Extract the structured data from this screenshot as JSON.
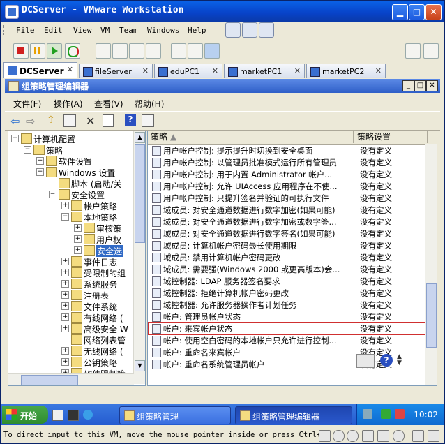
{
  "window": {
    "title": "DCServer - VMware Workstation"
  },
  "menu": [
    "File",
    "Edit",
    "View",
    "VM",
    "Team",
    "Windows",
    "Help"
  ],
  "tabs": [
    {
      "label": "DCServer",
      "active": true
    },
    {
      "label": "fileServer"
    },
    {
      "label": "eduPC1"
    },
    {
      "label": "marketPC1"
    },
    {
      "label": "marketPC2"
    }
  ],
  "inner": {
    "title": "组策略管理编辑器",
    "menu": [
      "文件(F)",
      "操作(A)",
      "查看(V)",
      "帮助(H)"
    ]
  },
  "tree": [
    {
      "label": "计算机配置",
      "exp": "−"
    },
    {
      "label": "策略",
      "exp": "−"
    },
    {
      "label": "软件设置",
      "exp": "+"
    },
    {
      "label": "Windows 设置",
      "exp": "−"
    },
    {
      "label": "脚本 (启动/关",
      "exp": ""
    },
    {
      "label": "安全设置",
      "exp": "−"
    },
    {
      "label": "帐户策略",
      "exp": "+"
    },
    {
      "label": "本地策略",
      "exp": "−"
    },
    {
      "label": "审核策",
      "exp": "+"
    },
    {
      "label": "用户权",
      "exp": "+"
    },
    {
      "label": "安全选",
      "exp": "+",
      "selected": true
    },
    {
      "label": "事件日志",
      "exp": "+"
    },
    {
      "label": "受限制的组",
      "exp": "+"
    },
    {
      "label": "系统服务",
      "exp": "+"
    },
    {
      "label": "注册表",
      "exp": "+"
    },
    {
      "label": "文件系统",
      "exp": "+"
    },
    {
      "label": "有线网络 (",
      "exp": "+"
    },
    {
      "label": "高级安全 W",
      "exp": "+"
    },
    {
      "label": "网络列表管",
      "exp": ""
    },
    {
      "label": "无线网络 (",
      "exp": "+"
    },
    {
      "label": "公钥策略",
      "exp": "+"
    },
    {
      "label": "软件限制策",
      "exp": "+"
    }
  ],
  "list": {
    "headers": {
      "policy": "策略",
      "setting": "策略设置"
    },
    "rows": [
      {
        "policy": "用户帐户控制: 提示提升时切换到安全桌面",
        "setting": "没有定义"
      },
      {
        "policy": "用户帐户控制: 以管理员批准模式运行所有管理员",
        "setting": "没有定义"
      },
      {
        "policy": "用户帐户控制: 用于内置 Administrator 帐户...",
        "setting": "没有定义"
      },
      {
        "policy": "用户帐户控制: 允许 UIAccess 应用程序在不使...",
        "setting": "没有定义"
      },
      {
        "policy": "用户帐户控制: 只提升签名并验证的可执行文件",
        "setting": "没有定义"
      },
      {
        "policy": "域成员: 对安全通道数据进行数字加密(如果可能)",
        "setting": "没有定义"
      },
      {
        "policy": "域成员: 对安全通道数据进行数字加密或数字签...",
        "setting": "没有定义"
      },
      {
        "policy": "域成员: 对安全通道数据进行数字签名(如果可能)",
        "setting": "没有定义"
      },
      {
        "policy": "域成员: 计算机帐户密码最长使用期限",
        "setting": "没有定义"
      },
      {
        "policy": "域成员: 禁用计算机帐户密码更改",
        "setting": "没有定义"
      },
      {
        "policy": "域成员: 需要强(Windows 2000 或更高版本)会...",
        "setting": "没有定义"
      },
      {
        "policy": "域控制器: LDAP 服务器签名要求",
        "setting": "没有定义"
      },
      {
        "policy": "域控制器: 拒绝计算机帐户密码更改",
        "setting": "没有定义"
      },
      {
        "policy": "域控制器: 允许服务器操作者计划任务",
        "setting": "没有定义"
      },
      {
        "policy": "帐户: 管理员帐户状态",
        "setting": "没有定义"
      },
      {
        "policy": "帐户: 来宾帐户状态",
        "setting": "没有定义",
        "highlight": true
      },
      {
        "policy": "帐户: 使用空白密码的本地帐户只允许进行控制...",
        "setting": "没有定义"
      },
      {
        "policy": "帐户: 重命名来宾帐户",
        "setting": "没有定义"
      },
      {
        "policy": "帐户: 重命名系统管理员帐户",
        "setting": "没有定义"
      }
    ]
  },
  "taskbar": {
    "start": "开始",
    "tasks": [
      "组策略管理",
      "组策略管理编辑器"
    ],
    "clock": "10:02"
  },
  "status": "To direct input to this VM, move the mouse pointer inside or press Ctrl+G."
}
